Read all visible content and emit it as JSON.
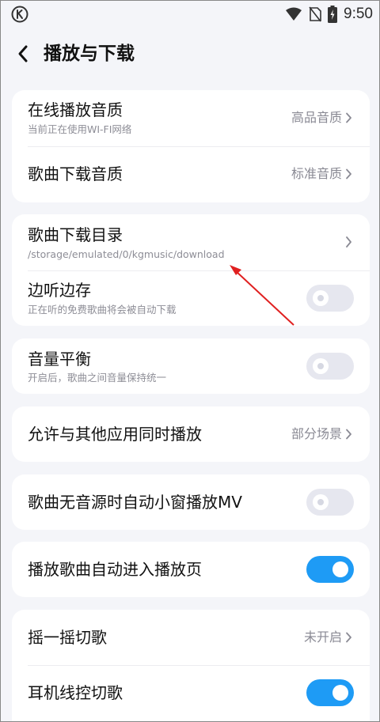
{
  "status_bar": {
    "time": "9:50",
    "icons": [
      "kugou-k-logo-icon",
      "wifi-icon",
      "no-sim-icon",
      "battery-charging-icon"
    ]
  },
  "header": {
    "back_icon": "chevron-left-icon",
    "title": "播放与下载"
  },
  "groups": [
    {
      "items": [
        {
          "title": "在线播放音质",
          "subtitle": "当前正在使用WI-FI网络",
          "value": "高品音质",
          "control": "chevron"
        },
        {
          "title": "歌曲下载音质",
          "value": "标准音质",
          "control": "chevron"
        }
      ]
    },
    {
      "items": [
        {
          "title": "歌曲下载目录",
          "subtitle": "/storage/emulated/0/kgmusic/download",
          "control": "chevron"
        },
        {
          "title": "边听边存",
          "subtitle": "正在听的免费歌曲将会被自动下载",
          "control": "toggle",
          "on": false
        }
      ]
    },
    {
      "items": [
        {
          "title": "音量平衡",
          "subtitle": "开启后，歌曲之间音量保持统一",
          "control": "toggle",
          "on": false
        }
      ]
    },
    {
      "items": [
        {
          "title": "允许与其他应用同时播放",
          "value": "部分场景",
          "control": "chevron"
        }
      ]
    },
    {
      "items": [
        {
          "title": "歌曲无音源时自动小窗播放MV",
          "control": "toggle",
          "on": false
        }
      ]
    },
    {
      "items": [
        {
          "title": "播放歌曲自动进入播放页",
          "control": "toggle",
          "on": true
        }
      ]
    },
    {
      "items": [
        {
          "title": "摇一摇切歌",
          "value": "未开启",
          "control": "chevron"
        },
        {
          "title": "耳机线控切歌",
          "control": "toggle",
          "on": true
        }
      ]
    }
  ],
  "colors": {
    "background": "#f4f5f9",
    "card": "#ffffff",
    "toggle_on": "#1e9bf5",
    "toggle_off": "#e6e7ef",
    "annotation_arrow": "#e02020"
  }
}
